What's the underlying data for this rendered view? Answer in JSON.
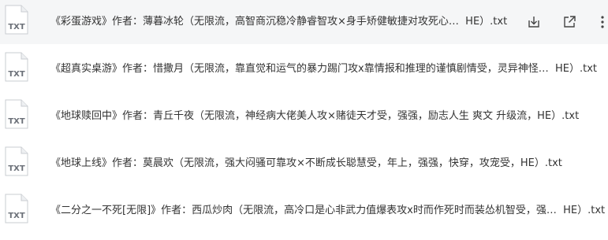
{
  "files": [
    {
      "icon_label": "TXT",
      "name": "《彩蛋游戏》作者：薄暮冰轮（无限流，高智商沉稳冷静睿智攻×身手矫健敏捷对攻死心…",
      "suffix": "HE）.txt",
      "actions": [
        {
          "icon": "download-icon"
        },
        {
          "icon": "share-icon"
        },
        {
          "icon": "more-icon"
        }
      ]
    },
    {
      "icon_label": "TXT",
      "name": "《超真实桌游》作者：惜撒月（无限流，靠直觉和运气的暴力踢门攻x靠情报和推理的谨慎剧情受，灵异神怪…",
      "suffix": "HE）.txt"
    },
    {
      "icon_label": "TXT",
      "name": "《地球赎回中》作者：青丘千夜（无限流，神经病大佬美人攻×赌徒天才受，强强，励志人生 爽文 升级流，HE）.txt",
      "suffix": ""
    },
    {
      "icon_label": "TXT",
      "name": "《地球上线》作者：莫晨欢（无限流，强大闷骚可靠攻×不断成长聪慧受，年上，强强，快穿，攻宠受，HE）.txt",
      "suffix": ""
    },
    {
      "icon_label": "TXT",
      "name": "《二分之一不死[无限]》作者：西瓜炒肉（无限流，高冷口是心非武力值爆表攻x时而作死时而装怂机智受，强…",
      "suffix": "HE）.txt"
    }
  ]
}
